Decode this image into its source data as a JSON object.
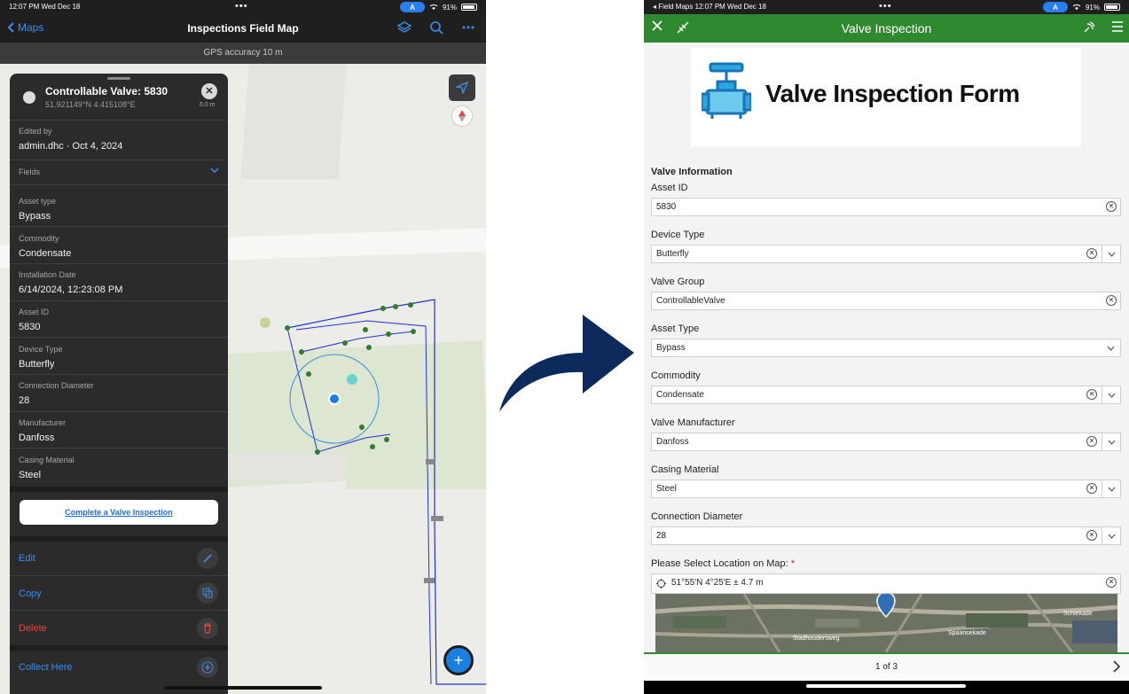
{
  "left": {
    "status": {
      "time": "12:07 PM  Wed Dec 18",
      "dots": "•••",
      "badge": "A",
      "battery": "91%"
    },
    "nav": {
      "back": "Maps",
      "title": "Inspections Field Map"
    },
    "gps": "GPS accuracy 10 m",
    "popup": {
      "title": "Controllable Valve: 5830",
      "coords": "51.921149°N  4.415108°E",
      "distance": "6.0 m",
      "edited_label": "Edited by",
      "edited_value": "admin.dhc · Oct 4, 2024",
      "fields_label": "Fields",
      "fields": [
        {
          "label": "Asset type",
          "value": "Bypass"
        },
        {
          "label": "Commodity",
          "value": "Condensate"
        },
        {
          "label": "Installation Date",
          "value": "6/14/2024, 12:23:08 PM"
        },
        {
          "label": "Asset ID",
          "value": "5830"
        },
        {
          "label": "Device Type",
          "value": "Butterfly"
        },
        {
          "label": "Connection Diameter",
          "value": "28"
        },
        {
          "label": "Manufacturer",
          "value": "Danfoss"
        },
        {
          "label": "Casing Material",
          "value": "Steel"
        }
      ],
      "cta": "Complete a Valve Inspection",
      "actions": {
        "edit": "Edit",
        "copy": "Copy",
        "delete": "Delete",
        "collect": "Collect Here"
      }
    }
  },
  "right": {
    "status": {
      "time": "◂ Field Maps  12:07 PM  Wed Dec 18",
      "dots": "•••",
      "badge": "A",
      "battery": "91%"
    },
    "header": {
      "title": "Valve Inspection"
    },
    "banner_title": "Valve Inspection Form",
    "section": "Valve Information",
    "fields": [
      {
        "label": "Asset ID",
        "value": "5830"
      },
      {
        "label": "Device Type",
        "value": "Butterfly"
      },
      {
        "label": "Valve Group",
        "value": "ControllableValve"
      },
      {
        "label": "Asset Type",
        "value": "Bypass"
      },
      {
        "label": "Commodity",
        "value": "Condensate"
      },
      {
        "label": "Valve Manufacturer",
        "value": "Danfoss"
      },
      {
        "label": "Casing Material",
        "value": "Steel"
      },
      {
        "label": "Connection Diameter",
        "value": "28"
      }
    ],
    "location_label": "Please Select Location on Map: ",
    "location_required": "*",
    "location_value": "51°55′N 4°25′E ± 4.7 m",
    "map_labels": [
      "Stadhoudersweg",
      "Spaansekade",
      "Schiekade"
    ],
    "footer": "1 of 3"
  },
  "colors": {
    "accent_blue": "#3b8ef0",
    "form_green": "#2f8a2f",
    "delete_red": "#e5483d",
    "arrow_navy": "#0d2a5c"
  }
}
